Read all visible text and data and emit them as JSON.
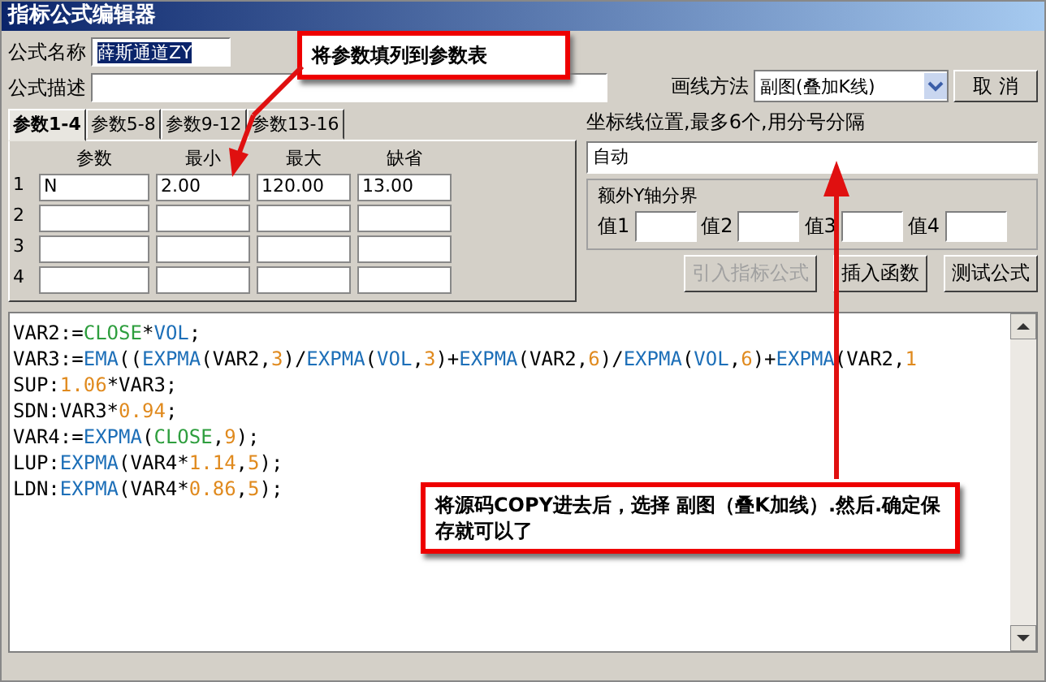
{
  "window": {
    "title": "指标公式编辑器"
  },
  "formula_name": {
    "label": "公式名称",
    "value": "薛斯通道ZY",
    "highlighted": true
  },
  "formula_desc": {
    "label": "公式描述"
  },
  "draw_method": {
    "label": "画线方法",
    "value": "副图(叠加K线)"
  },
  "cancel_button": "取 消",
  "tabs": [
    {
      "label": "参数1-4",
      "selected": true
    },
    {
      "label": "参数5-8",
      "selected": false
    },
    {
      "label": "参数9-12",
      "selected": false
    },
    {
      "label": "参数13-16",
      "selected": false
    }
  ],
  "param_table": {
    "columns": [
      "参数",
      "最小",
      "最大",
      "缺省"
    ],
    "rows": [
      {
        "index": "1",
        "cells": [
          "N",
          "2.00",
          "120.00",
          "13.00"
        ]
      },
      {
        "index": "2",
        "cells": []
      },
      {
        "index": "3",
        "cells": []
      },
      {
        "index": "4",
        "cells": []
      }
    ]
  },
  "axis_lines": {
    "label": "坐标线位置,最多6个,用分号分隔",
    "value": "自动"
  },
  "y_axis_group": {
    "title": "额外Y轴分界",
    "fields": [
      "值1",
      "值2",
      "值3",
      "值4"
    ]
  },
  "buttons": [
    {
      "label": "引入指标公式",
      "disabled": true
    },
    {
      "label": "插入函数",
      "disabled": false
    },
    {
      "label": "测试公式",
      "disabled": false
    }
  ],
  "code_lines": [
    [
      {
        "text": "VAR2:=",
        "kind": "plain"
      },
      {
        "text": "CLOSE",
        "kind": "const"
      },
      {
        "text": "*",
        "kind": "plain"
      },
      {
        "text": "VOL",
        "kind": "func"
      },
      {
        "text": ";",
        "kind": "plain"
      }
    ],
    [
      {
        "text": "VAR3:=",
        "kind": "plain"
      },
      {
        "text": "EMA",
        "kind": "func"
      },
      {
        "text": "((",
        "kind": "plain"
      },
      {
        "text": "EXPMA",
        "kind": "func"
      },
      {
        "text": "(VAR2,",
        "kind": "plain"
      },
      {
        "text": "3",
        "kind": "num"
      },
      {
        "text": ")/",
        "kind": "plain"
      },
      {
        "text": "EXPMA",
        "kind": "func"
      },
      {
        "text": "(",
        "kind": "plain"
      },
      {
        "text": "VOL",
        "kind": "func"
      },
      {
        "text": ",",
        "kind": "plain"
      },
      {
        "text": "3",
        "kind": "num"
      },
      {
        "text": ")+",
        "kind": "plain"
      },
      {
        "text": "EXPMA",
        "kind": "func"
      },
      {
        "text": "(VAR2,",
        "kind": "plain"
      },
      {
        "text": "6",
        "kind": "num"
      },
      {
        "text": ")/",
        "kind": "plain"
      },
      {
        "text": "EXPMA",
        "kind": "func"
      },
      {
        "text": "(",
        "kind": "plain"
      },
      {
        "text": "VOL",
        "kind": "func"
      },
      {
        "text": ",",
        "kind": "plain"
      },
      {
        "text": "6",
        "kind": "num"
      },
      {
        "text": ")+",
        "kind": "plain"
      },
      {
        "text": "EXPMA",
        "kind": "func"
      },
      {
        "text": "(VAR2,",
        "kind": "plain"
      },
      {
        "text": "1",
        "kind": "num"
      }
    ],
    [
      {
        "text": "SUP:",
        "kind": "plain"
      },
      {
        "text": "1.06",
        "kind": "num"
      },
      {
        "text": "*VAR3;",
        "kind": "plain"
      }
    ],
    [
      {
        "text": "SDN:VAR3*",
        "kind": "plain"
      },
      {
        "text": "0.94",
        "kind": "num"
      },
      {
        "text": ";",
        "kind": "plain"
      }
    ],
    [
      {
        "text": "VAR4:=",
        "kind": "plain"
      },
      {
        "text": "EXPMA",
        "kind": "func"
      },
      {
        "text": "(",
        "kind": "plain"
      },
      {
        "text": "CLOSE",
        "kind": "const"
      },
      {
        "text": ",",
        "kind": "plain"
      },
      {
        "text": "9",
        "kind": "num"
      },
      {
        "text": ");",
        "kind": "plain"
      }
    ],
    [
      {
        "text": "LUP:",
        "kind": "plain"
      },
      {
        "text": "EXPMA",
        "kind": "func"
      },
      {
        "text": "(VAR4*",
        "kind": "plain"
      },
      {
        "text": "1.14",
        "kind": "num"
      },
      {
        "text": ",",
        "kind": "plain"
      },
      {
        "text": "5",
        "kind": "num"
      },
      {
        "text": ");",
        "kind": "plain"
      }
    ],
    [
      {
        "text": "LDN:",
        "kind": "plain"
      },
      {
        "text": "EXPMA",
        "kind": "func"
      },
      {
        "text": "(VAR4*",
        "kind": "plain"
      },
      {
        "text": "0.86",
        "kind": "num"
      },
      {
        "text": ",",
        "kind": "plain"
      },
      {
        "text": "5",
        "kind": "num"
      },
      {
        "text": ");",
        "kind": "plain"
      }
    ]
  ],
  "annotations": [
    "将参数填列到参数表",
    "将源码COPY进去后，选择 副图（叠K加线）.然后.确定保存就可以了"
  ]
}
